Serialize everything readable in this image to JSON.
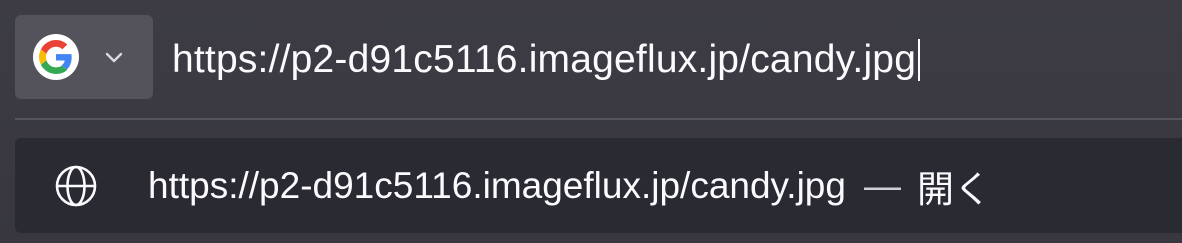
{
  "urlbar": {
    "engine_icon": "google-icon",
    "dropdown_icon": "chevron-down-icon",
    "value": "https://p2-d91c5116.imageflux.jp/candy.jpg"
  },
  "suggestion": {
    "icon": "globe-icon",
    "url": "https://p2-d91c5116.imageflux.jp/candy.jpg",
    "separator": "—",
    "action": "開く"
  },
  "colors": {
    "background": "#3d3c45",
    "engine_button": "#54535c",
    "popup": "#2a2a33",
    "text": "#fbfbfe"
  }
}
